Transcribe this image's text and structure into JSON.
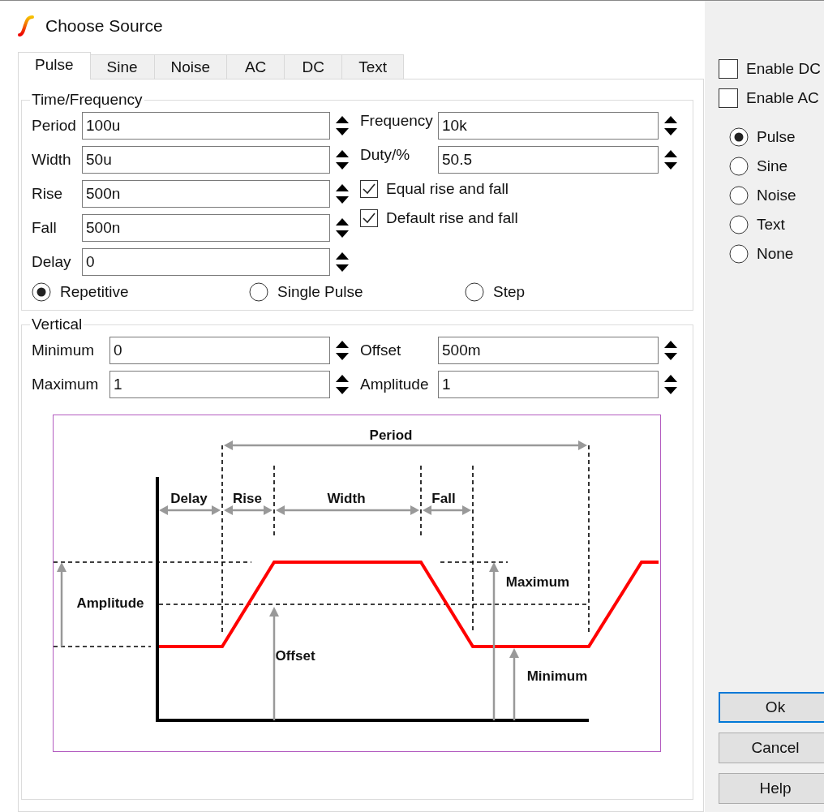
{
  "window": {
    "title": "Choose Source"
  },
  "tabs": [
    {
      "label": "Pulse",
      "selected": true
    },
    {
      "label": "Sine",
      "selected": false
    },
    {
      "label": "Noise",
      "selected": false
    },
    {
      "label": "AC",
      "selected": false
    },
    {
      "label": "DC",
      "selected": false
    },
    {
      "label": "Text",
      "selected": false
    }
  ],
  "time_frequency": {
    "title": "Time/Frequency",
    "left_fields": [
      {
        "label": "Period",
        "value": "100u"
      },
      {
        "label": "Width",
        "value": "50u"
      },
      {
        "label": "Rise",
        "value": "500n"
      },
      {
        "label": "Fall",
        "value": "500n"
      },
      {
        "label": "Delay",
        "value": "0"
      }
    ],
    "right_fields": [
      {
        "label": "Frequency",
        "value": "10k"
      },
      {
        "label": "Duty/%",
        "value": "50.5"
      }
    ],
    "checkboxes": [
      {
        "label": "Equal rise and fall",
        "checked": true
      },
      {
        "label": "Default rise and fall",
        "checked": true
      }
    ],
    "modes": [
      {
        "label": "Repetitive",
        "selected": true
      },
      {
        "label": "Single Pulse",
        "selected": false
      },
      {
        "label": "Step",
        "selected": false
      }
    ]
  },
  "vertical": {
    "title": "Vertical",
    "left_fields": [
      {
        "label": "Minimum",
        "value": "0"
      },
      {
        "label": "Maximum",
        "value": "1"
      }
    ],
    "right_fields": [
      {
        "label": "Offset",
        "value": "500m"
      },
      {
        "label": "Amplitude",
        "value": "1"
      }
    ]
  },
  "diagram": {
    "labels": [
      "Period",
      "Delay",
      "Rise",
      "Width",
      "Fall",
      "Amplitude",
      "Maximum",
      "Offset",
      "Minimum"
    ]
  },
  "side_panel": {
    "enable": [
      {
        "label": "Enable DC",
        "checked": false
      },
      {
        "label": "Enable AC",
        "checked": false
      }
    ],
    "sources": [
      {
        "label": "Pulse",
        "selected": true
      },
      {
        "label": "Sine",
        "selected": false
      },
      {
        "label": "Noise",
        "selected": false
      },
      {
        "label": "Text",
        "selected": false
      },
      {
        "label": "None",
        "selected": false
      }
    ]
  },
  "buttons": [
    {
      "label": "Ok",
      "default": true
    },
    {
      "label": "Cancel",
      "default": false
    },
    {
      "label": "Help",
      "default": false
    }
  ]
}
